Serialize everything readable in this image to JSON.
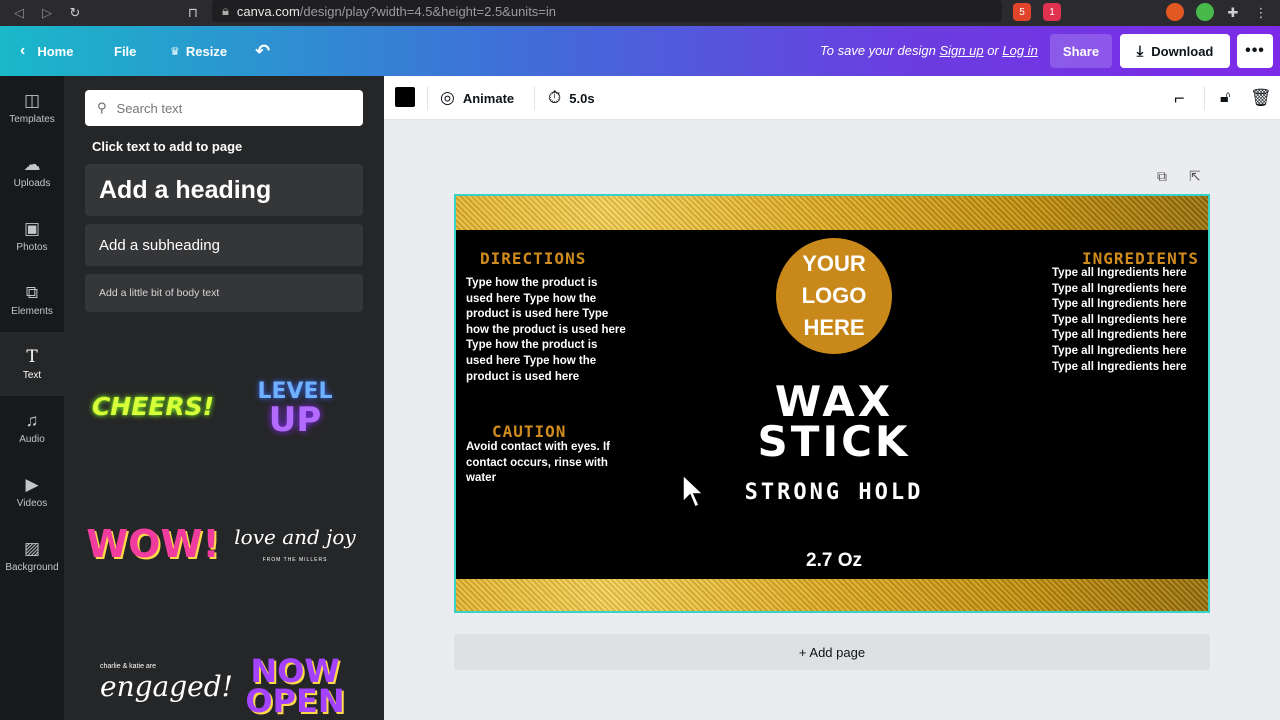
{
  "browser": {
    "url_host": "canva.com",
    "url_path": "/design/play?width=4.5&height=2.5&units=in",
    "ext_badge_1": "5",
    "ext_badge_2": "1"
  },
  "topbar": {
    "home": "Home",
    "file": "File",
    "resize": "Resize",
    "save_prefix": "To save your design ",
    "sign_up": "Sign up",
    "or": " or ",
    "log_in": "Log in",
    "share": "Share",
    "download": "Download"
  },
  "rail": {
    "items": [
      {
        "label": "Templates",
        "icon": "templates-icon"
      },
      {
        "label": "Uploads",
        "icon": "upload-icon"
      },
      {
        "label": "Photos",
        "icon": "photo-icon"
      },
      {
        "label": "Elements",
        "icon": "elements-icon"
      },
      {
        "label": "Text",
        "icon": "text-icon"
      },
      {
        "label": "Audio",
        "icon": "audio-icon"
      },
      {
        "label": "Videos",
        "icon": "video-icon"
      },
      {
        "label": "Background",
        "icon": "background-icon"
      }
    ]
  },
  "panel": {
    "search_placeholder": "Search text",
    "hint": "Click text to add to page",
    "heading": "Add a heading",
    "subheading": "Add a subheading",
    "body": "Add a little bit of body text",
    "stickers": {
      "cheers": "CHEERS!",
      "level": "LEVEL",
      "up": "UP",
      "wow": "WOW!",
      "love": "love and joy",
      "love_sub": "FROM THE MILLERS",
      "engaged_top": "charlie & katie are",
      "engaged": "engaged!",
      "now": "NOW",
      "open": "OPEN"
    }
  },
  "toolbar": {
    "color": "#000000",
    "animate": "Animate",
    "duration": "5.0s"
  },
  "design": {
    "directions_title": "DIRECTIONS",
    "directions_body": "Type how the product is used here Type how the product is used here Type how the product is used here Type how the product is used here Type how the product is used here",
    "caution_title": "CAUTION",
    "caution_body": "Avoid contact with eyes. If contact occurs, rinse with water",
    "logo_line1": "YOUR",
    "logo_line2": "LOGO",
    "logo_line3": "HERE",
    "wax": "WAX",
    "stick": "STICK",
    "strong_hold": "STRONG HOLD",
    "weight": "2.7 Oz",
    "ingredients_title": "INGREDIENTS",
    "ingredients": [
      "Type all Ingredients here",
      "Type all Ingredients here",
      "Type all Ingredients here",
      "Type all Ingredients here",
      "Type all Ingredients here",
      "Type all Ingredients here",
      "Type all Ingredients here"
    ]
  },
  "add_page": "+ Add page",
  "colors": {
    "accent_teal": "#1ab8c9",
    "accent_purple": "#7d2ae8",
    "gold": "#d08b1e",
    "selection": "#37d3c8"
  }
}
